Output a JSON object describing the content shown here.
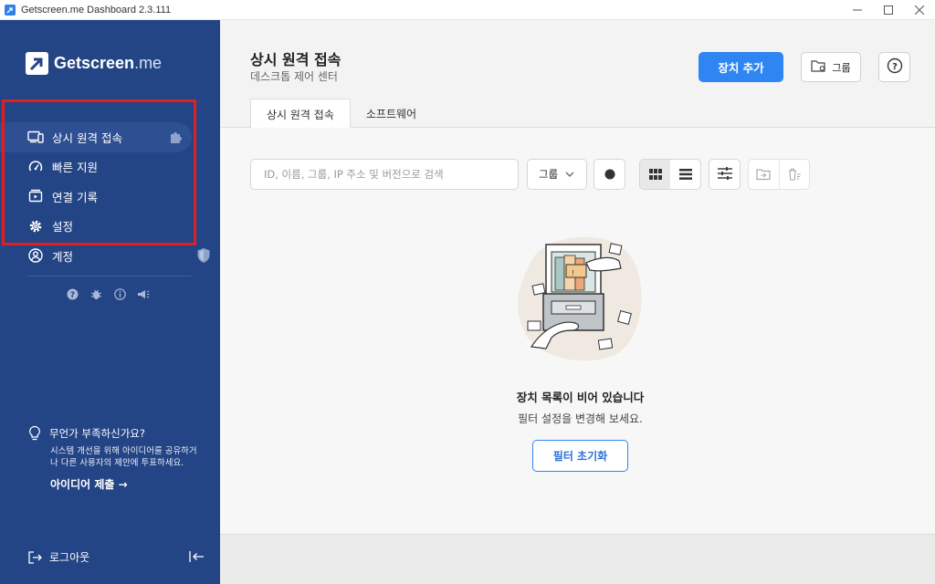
{
  "window": {
    "title": "Getscreen.me Dashboard 2.3.111",
    "minimize": "—",
    "maximize": "☐",
    "close": "✕"
  },
  "brand": {
    "name": "Getscreen",
    "suffix": ".me"
  },
  "sidebar": {
    "items": [
      {
        "label": "상시 원격 접속",
        "icon": "devices-icon",
        "badge": "puzzle-icon"
      },
      {
        "label": "빠른 지원",
        "icon": "speedometer-icon"
      },
      {
        "label": "연결 기록",
        "icon": "history-icon"
      },
      {
        "label": "설정",
        "icon": "gear-icon"
      },
      {
        "label": "계정",
        "icon": "user-circle-icon",
        "badge": "shield-icon"
      }
    ],
    "mini_icons": [
      "help-icon",
      "bug-icon",
      "info-icon",
      "megaphone-icon"
    ],
    "idea": {
      "question": "무언가 부족하신가요?",
      "description": "시스템 개선을 위해 아이디어를 공유하거나 다른 사용자의 제안에 투표하세요.",
      "submit": "아이디어 제출 →"
    },
    "logout": "로그아웃"
  },
  "header": {
    "title": "상시 원격 접속",
    "subtitle": "데스크톱 제어 센터",
    "add_device": "장치 추가",
    "group": "그룹",
    "tabs": [
      "상시 원격 접속",
      "소프트웨어"
    ]
  },
  "toolbar": {
    "search_placeholder": "ID, 이름, 그룹, IP 주소 및 버전으로 검색",
    "group_select": "그룹"
  },
  "empty": {
    "title": "장치 목록이 비어 있습니다",
    "subtitle": "필터 설정을 변경해 보세요.",
    "reset": "필터 초기화"
  },
  "colors": {
    "sidebar": "#234485",
    "accent": "#2f86f3",
    "highlight": "#e02020"
  }
}
